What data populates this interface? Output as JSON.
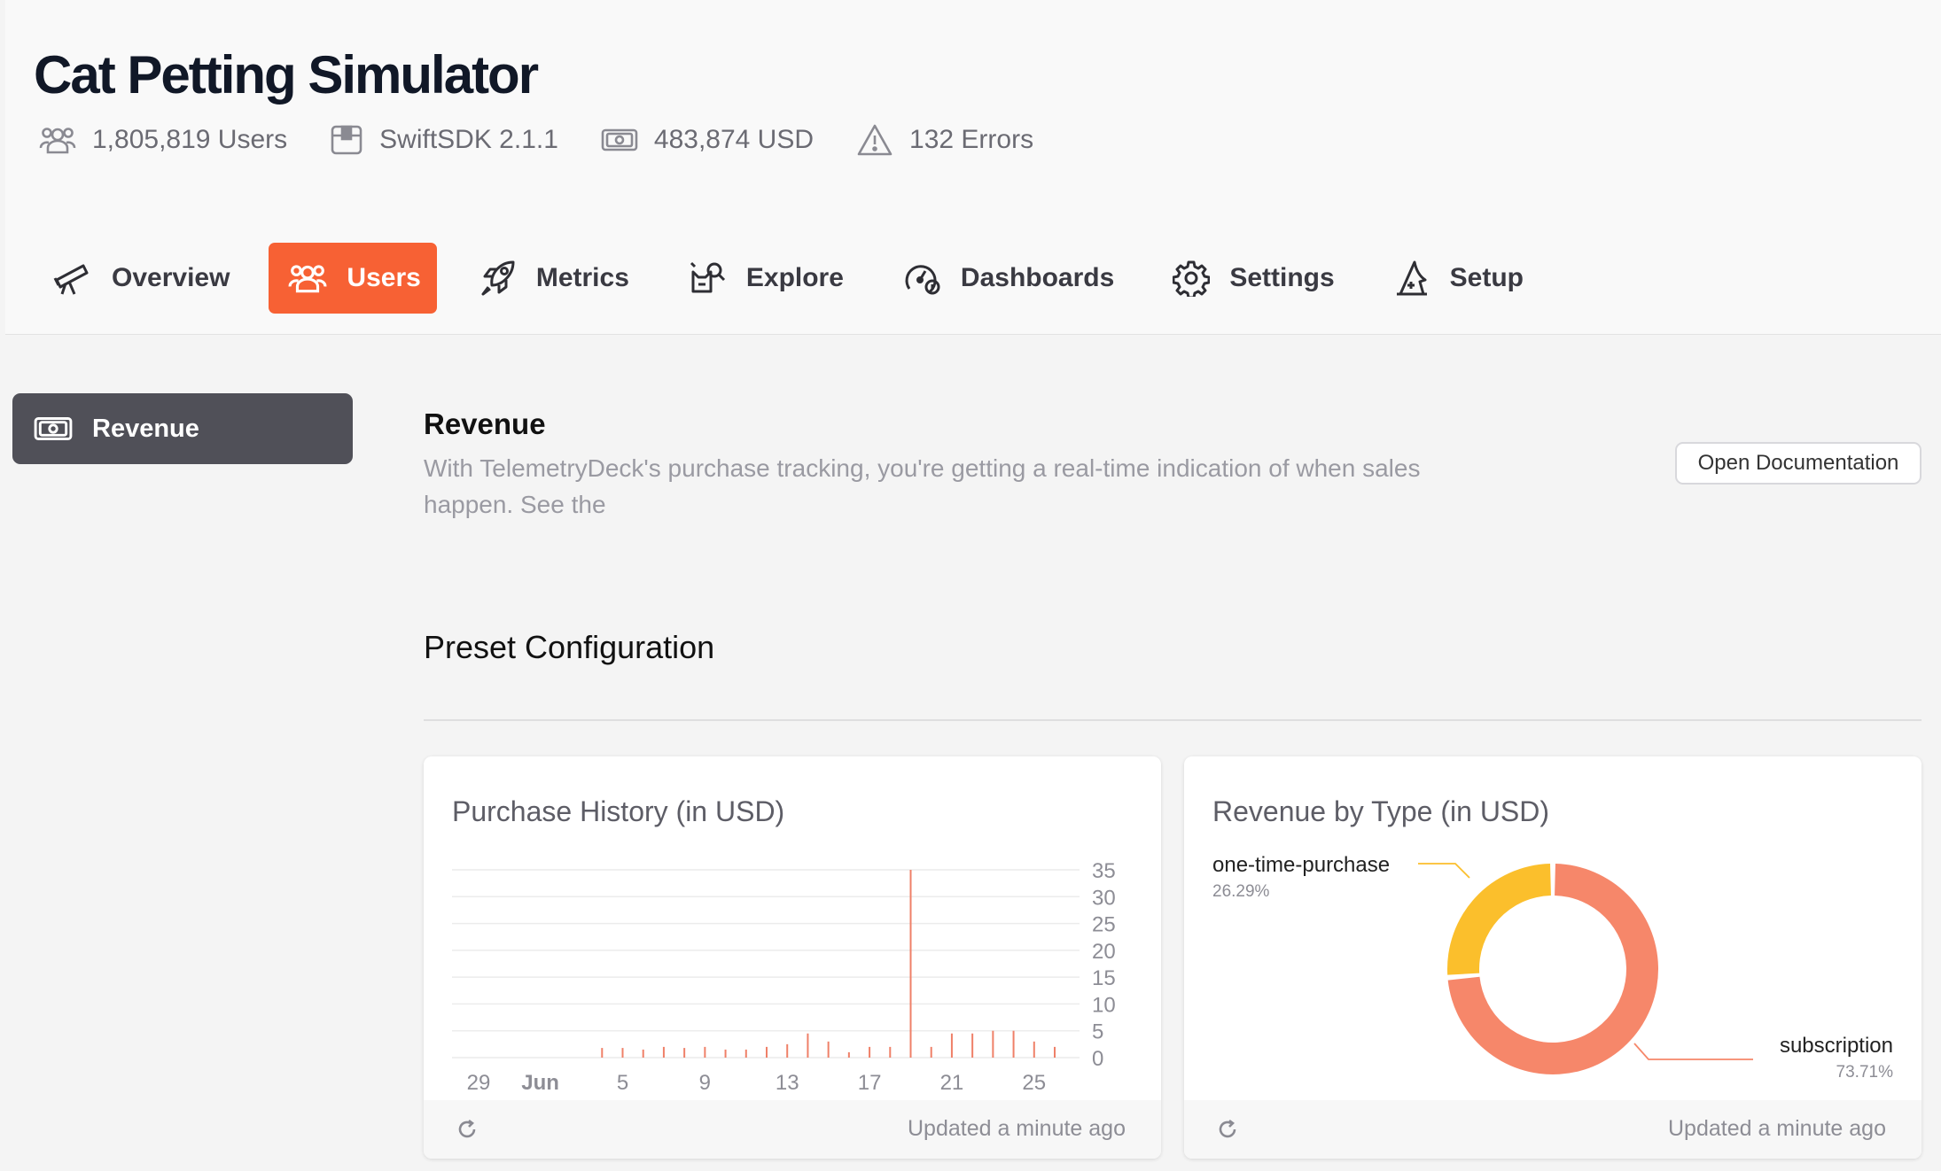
{
  "app": {
    "title": "Cat Petting Simulator",
    "stats": {
      "users": "1,805,819 Users",
      "sdk": "SwiftSDK 2.1.1",
      "revenue": "483,874 USD",
      "errors": "132 Errors"
    }
  },
  "nav": {
    "tabs": [
      {
        "label": "Overview",
        "icon": "telescope-icon"
      },
      {
        "label": "Users",
        "icon": "users-icon"
      },
      {
        "label": "Metrics",
        "icon": "rocket-icon"
      },
      {
        "label": "Explore",
        "icon": "cat-search-icon"
      },
      {
        "label": "Dashboards",
        "icon": "gauge-icon"
      },
      {
        "label": "Settings",
        "icon": "gear-icon"
      },
      {
        "label": "Setup",
        "icon": "wizard-hat-icon"
      }
    ],
    "active": "Users"
  },
  "sidebar": {
    "items": [
      {
        "label": "Revenue",
        "icon": "banknote-icon"
      }
    ]
  },
  "main": {
    "title": "Revenue",
    "description": "With TelemetryDeck's purchase tracking, you're getting a real-time indication of when sales happen. See the",
    "doc_button": "Open Documentation",
    "preset_title": "Preset Configuration"
  },
  "cards": [
    {
      "title": "Purchase History (in USD)",
      "updated": "Updated a minute ago"
    },
    {
      "title": "Revenue by Type (in USD)",
      "updated": "Updated a minute ago"
    }
  ],
  "colors": {
    "accent": "#f76134",
    "bar": "#ef8068",
    "slice_subscription": "#f6876a",
    "slice_one_time": "#fbbf2c"
  },
  "chart_data": [
    {
      "type": "bar",
      "title": "Purchase History (in USD)",
      "x_tick_labels": [
        "29",
        "Jun",
        "5",
        "9",
        "13",
        "17",
        "21",
        "25"
      ],
      "y_ticks": [
        0,
        5,
        10,
        15,
        20,
        25,
        30,
        35
      ],
      "ylim": [
        0,
        35
      ],
      "grid": true,
      "y_axis_side": "right",
      "x": [
        "May 29",
        "May 30",
        "May 31",
        "Jun 1",
        "Jun 2",
        "Jun 3",
        "Jun 4",
        "Jun 5",
        "Jun 6",
        "Jun 7",
        "Jun 8",
        "Jun 9",
        "Jun 10",
        "Jun 11",
        "Jun 12",
        "Jun 13",
        "Jun 14",
        "Jun 15",
        "Jun 16",
        "Jun 17",
        "Jun 18",
        "Jun 19",
        "Jun 20",
        "Jun 21",
        "Jun 22",
        "Jun 23",
        "Jun 24",
        "Jun 25",
        "Jun 26"
      ],
      "values": [
        0,
        0,
        0,
        0,
        0,
        0,
        1.8,
        1.8,
        1.5,
        2,
        1.8,
        2,
        1.5,
        1.5,
        2,
        2.5,
        4.5,
        3,
        1,
        2,
        2,
        35,
        2,
        4.5,
        4.5,
        5,
        5,
        3,
        2
      ]
    },
    {
      "type": "pie",
      "title": "Revenue by Type (in USD)",
      "labels": [
        "subscription",
        "one-time-purchase"
      ],
      "values": [
        73.71,
        26.29
      ],
      "value_labels": [
        "73.71%",
        "26.29%"
      ]
    }
  ]
}
